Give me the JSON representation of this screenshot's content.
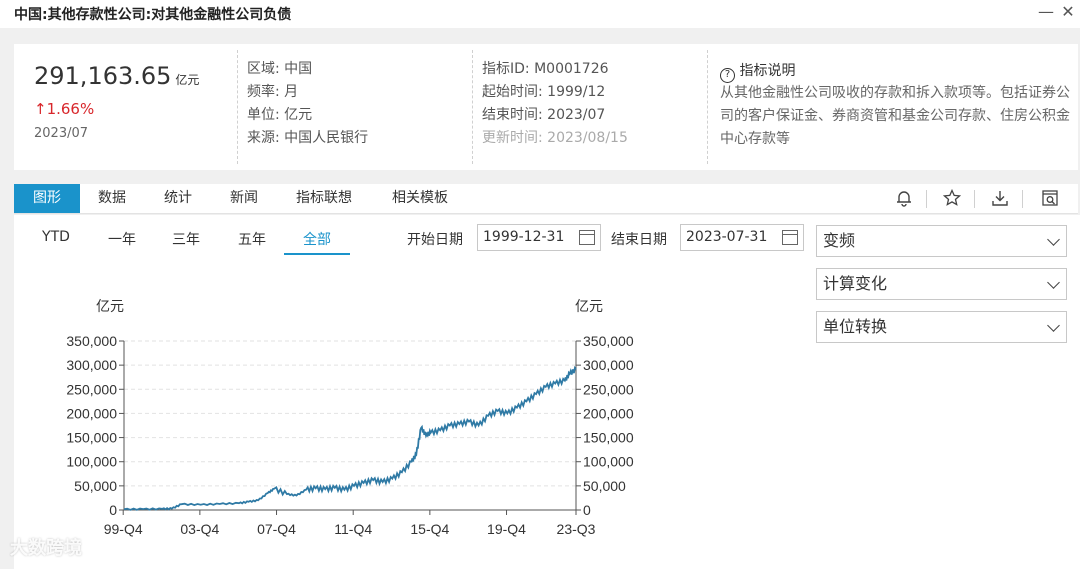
{
  "window": {
    "title": "中国:其他存款性公司:对其他金融性公司负债",
    "minimize": "—",
    "close": "✕"
  },
  "summary": {
    "value": "291,163.65",
    "unit": "亿元",
    "change": "↑1.66%",
    "period": "2023/07",
    "meta1": [
      {
        "label": "区域",
        "value": "中国"
      },
      {
        "label": "频率",
        "value": "月"
      },
      {
        "label": "单位",
        "value": "亿元"
      },
      {
        "label": "来源",
        "value": "中国人民银行"
      }
    ],
    "meta2": [
      {
        "label": "指标ID",
        "value": "M0001726"
      },
      {
        "label": "起始时间",
        "value": "1999/12"
      },
      {
        "label": "结束时间",
        "value": "2023/07"
      },
      {
        "label": "更新时间",
        "value": "2023/08/15"
      }
    ],
    "description_title": "指标说明",
    "description": "从其他金融性公司吸收的存款和拆入款项等。包括证券公司的客户保证金、券商资管和基金公司存款、住房公积金中心存款等"
  },
  "tabs": [
    "图形",
    "数据",
    "统计",
    "新闻",
    "指标联想",
    "相关模板"
  ],
  "toolbar_icons": [
    "bell-icon",
    "star-icon",
    "download-icon",
    "search-window-icon"
  ],
  "ranges": [
    "YTD",
    "一年",
    "三年",
    "五年",
    "全部"
  ],
  "active_range": "全部",
  "date_filter": {
    "start_label": "开始日期",
    "start_value": "1999-12-31",
    "end_label": "结束日期",
    "end_value": "2023-07-31"
  },
  "side_dropdowns": [
    "变频",
    "计算变化",
    "单位转换"
  ],
  "watermark": "大数跨境",
  "colors": {
    "accent": "#1a93cb",
    "line": "#2f7aa5",
    "up": "#d8262b"
  },
  "chart_data": {
    "type": "line",
    "ylabel_left": "亿元",
    "ylabel_right": "亿元",
    "ylim": [
      0,
      350000
    ],
    "yticks": [
      "0",
      "50,000",
      "100,000",
      "150,000",
      "200,000",
      "250,000",
      "300,000",
      "350,000"
    ],
    "xticks": [
      "99-Q4",
      "03-Q4",
      "07-Q4",
      "11-Q4",
      "15-Q4",
      "19-Q4",
      "23-Q3"
    ],
    "grid": true,
    "series": [
      {
        "x": [
          "1999-12",
          "2000-12",
          "2001-12",
          "2002-06",
          "2002-12",
          "2003-12",
          "2004-12",
          "2005-12",
          "2006-06",
          "2006-12",
          "2007-06",
          "2007-10",
          "2008-06",
          "2008-12",
          "2009-06",
          "2009-12",
          "2010-06",
          "2010-12",
          "2011-06",
          "2011-12",
          "2012-06",
          "2012-12",
          "2013-06",
          "2013-12",
          "2014-06",
          "2014-12",
          "2015-03",
          "2015-06",
          "2015-09",
          "2015-12",
          "2016-06",
          "2016-12",
          "2017-06",
          "2017-12",
          "2018-06",
          "2018-12",
          "2019-06",
          "2019-12",
          "2020-06",
          "2020-12",
          "2021-06",
          "2021-12",
          "2022-06",
          "2022-12",
          "2023-03",
          "2023-07"
        ],
        "y": [
          1500,
          1800,
          2200,
          3000,
          12000,
          11000,
          12500,
          14000,
          17000,
          20000,
          35000,
          44000,
          33000,
          30000,
          42000,
          45000,
          43000,
          46000,
          42000,
          50000,
          56000,
          62000,
          58000,
          65000,
          78000,
          100000,
          115000,
          170000,
          155000,
          160000,
          165000,
          175000,
          178000,
          183000,
          175000,
          195000,
          205000,
          200000,
          212000,
          225000,
          240000,
          255000,
          262000,
          268000,
          282000,
          291164
        ]
      }
    ]
  }
}
